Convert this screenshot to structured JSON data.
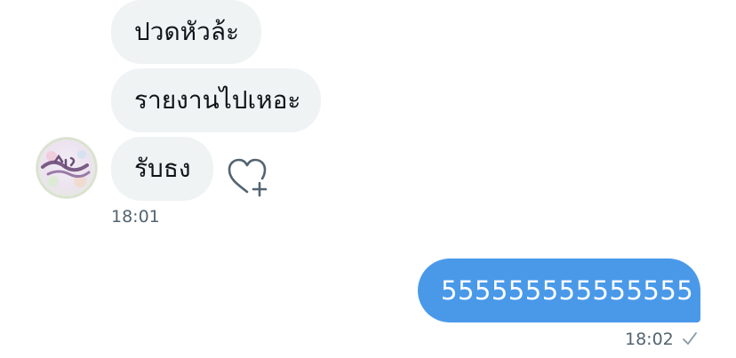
{
  "conversation": {
    "incoming": [
      {
        "text": "ปวดหัวล้ะ"
      },
      {
        "text": "รายงานไปเหอะ"
      },
      {
        "text": "รับธง"
      }
    ],
    "incoming_time": "18:01",
    "outgoing": [
      {
        "text": "555555555555555"
      }
    ],
    "outgoing_time": "18:02"
  },
  "icons": {
    "react": "heart-plus-icon",
    "status": "checkmark-icon",
    "avatar": "sender-avatar"
  },
  "colors": {
    "incoming_bubble": "#eff3f4",
    "outgoing_bubble": "#4a99e9",
    "timestamp": "#536471",
    "text": "#0f1419"
  }
}
